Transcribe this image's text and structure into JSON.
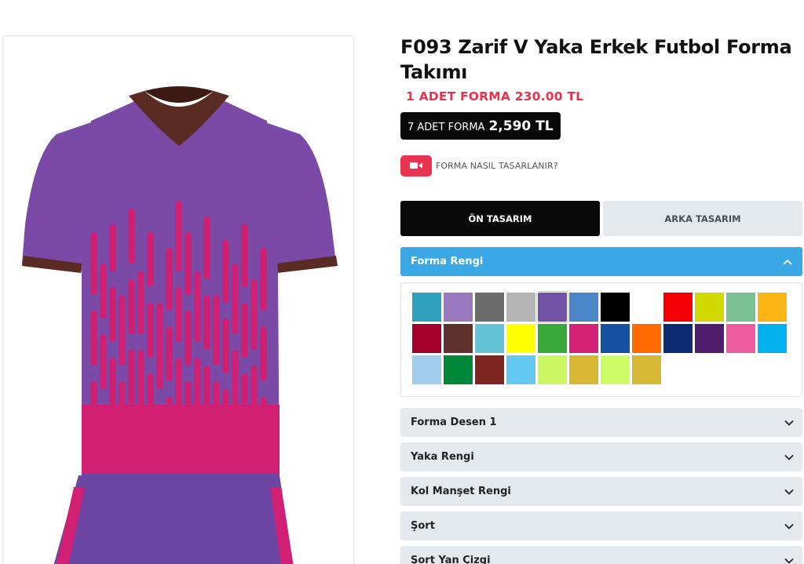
{
  "product": {
    "title": "F093 Zarif V Yaka Erkek Futbol Forma Takımı",
    "price_single": "1 ADET FORMA 230.00 TL",
    "price_bulk_label": "7 ADET FORMA",
    "price_bulk_value": "2,590 TL",
    "video_text": "FORMA NASIL TASARLANIR?"
  },
  "tabs": [
    {
      "label": "ÖN TASARIM",
      "active": true
    },
    {
      "label": "ARKA TASARIM",
      "active": false
    }
  ],
  "color_section": {
    "title": "Forma Rengi",
    "expanded": true,
    "selected_index": 4,
    "swatches": [
      "#2fa1bd",
      "#9a78c0",
      "#6b6b6b",
      "#b4b4b4",
      "#7152a4",
      "#4a86c7",
      "#000000",
      "#ffffff",
      "#f40000",
      "#d2d900",
      "#79c093",
      "#fbb615",
      "#a4002c",
      "#5d302b",
      "#64c3d8",
      "#feff00",
      "#3aa73c",
      "#d42175",
      "#1850a0",
      "#ff6a00",
      "#0e2b71",
      "#4d1d6b",
      "#ef5ba1",
      "#00b0ef",
      "#a1cef0",
      "#00873a",
      "#7f2623",
      "#63c9f0",
      "#caf762",
      "#d9b632",
      "#ccfb64",
      "#d6b734"
    ]
  },
  "accordions": [
    {
      "label": "Forma Desen 1"
    },
    {
      "label": "Yaka Rengi"
    },
    {
      "label": "Kol Manşet Rengi"
    },
    {
      "label": "Şort"
    },
    {
      "label": "Şort Yan Çizgi"
    }
  ],
  "jersey_colors": {
    "body": "#7a4aa6",
    "pattern": "#d11f74",
    "collar": "#5a2b22",
    "shorts": "#6d45a2"
  },
  "icons": {
    "video": "video-camera-icon",
    "chevron_up": "chevron-up-icon",
    "chevron_down": "chevron-down-icon"
  }
}
